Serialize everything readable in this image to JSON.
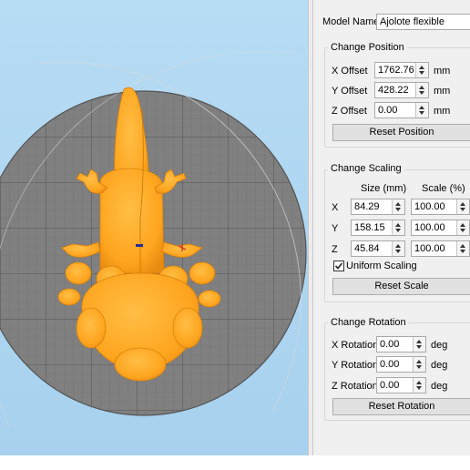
{
  "model_name": {
    "label": "Model Name:",
    "value": "Ajolote flexible"
  },
  "change_position": {
    "title": "Change Position",
    "x_label": "X Offset",
    "x_value": "1762.76",
    "x_unit": "mm",
    "y_label": "Y Offset",
    "y_value": "428.22",
    "y_unit": "mm",
    "z_label": "Z Offset",
    "z_value": "0.00",
    "z_unit": "mm",
    "reset_label": "Reset Position"
  },
  "change_scaling": {
    "title": "Change Scaling",
    "size_header": "Size (mm)",
    "scale_header": "Scale (%)",
    "rows": [
      {
        "axis": "X",
        "size": "84.29",
        "scale": "100.00"
      },
      {
        "axis": "Y",
        "size": "158.15",
        "scale": "100.00"
      },
      {
        "axis": "Z",
        "size": "45.84",
        "scale": "100.00"
      }
    ],
    "uniform_label": "Uniform Scaling",
    "uniform_checked": true,
    "reset_label": "Reset Scale"
  },
  "change_rotation": {
    "title": "Change Rotation",
    "x_label": "X Rotation",
    "x_value": "0.00",
    "x_unit": "deg",
    "y_label": "Y Rotation",
    "y_value": "0.00",
    "y_unit": "deg",
    "z_label": "Z Rotation",
    "z_value": "0.00",
    "z_unit": "deg",
    "reset_label": "Reset Rotation"
  },
  "viewport": {
    "sky_color": "#a9d3ef",
    "bed_color": "#7f7f7f",
    "model_color": "#ffa51f"
  }
}
